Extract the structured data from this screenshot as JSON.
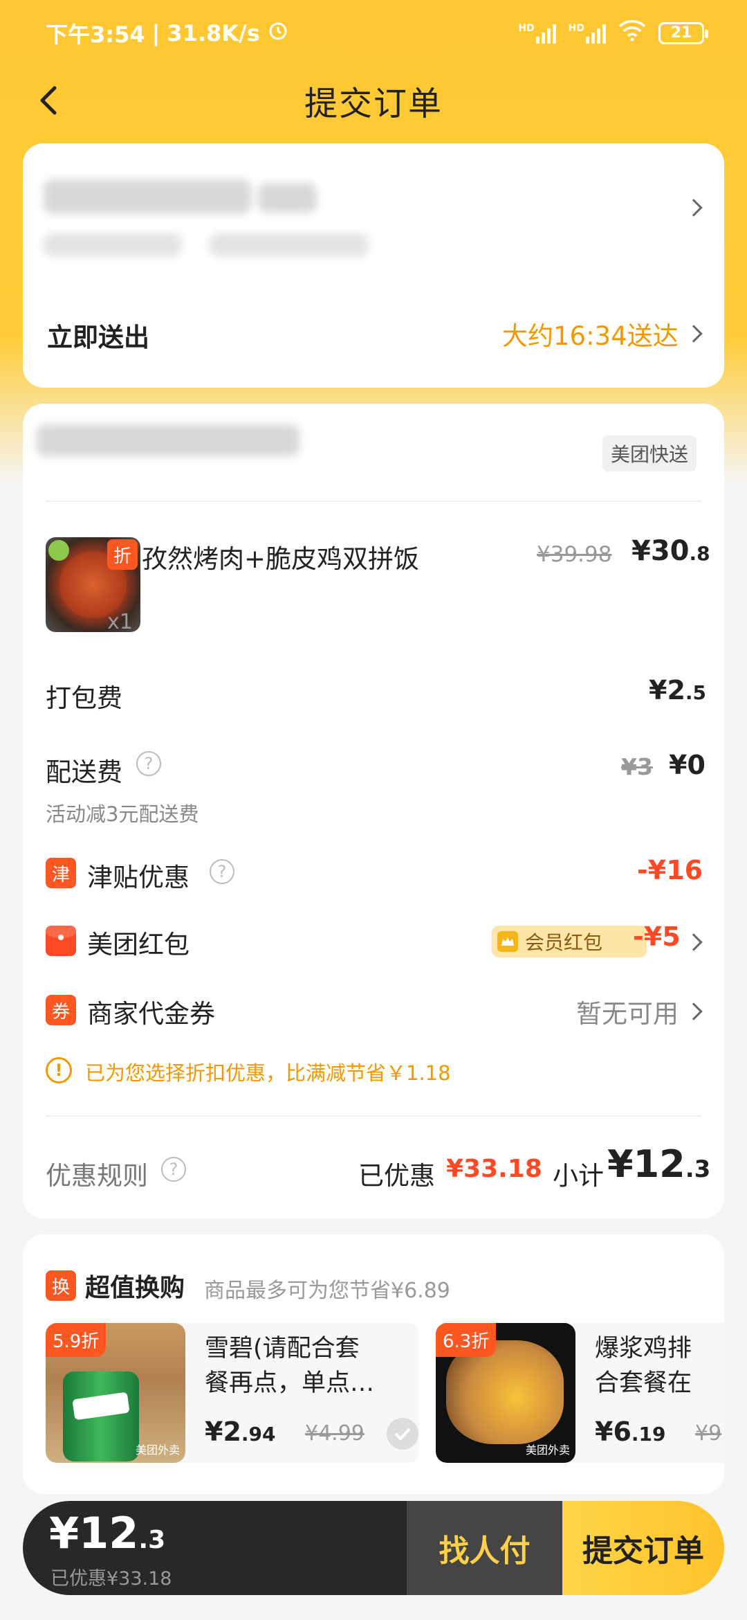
{
  "status_bar": {
    "time": "下午3:54",
    "speed": "31.8K/s",
    "hd1": "HD",
    "hd2": "HD",
    "battery": "21"
  },
  "nav": {
    "title": "提交订单"
  },
  "address": {
    "delivery_label": "立即送出",
    "eta": "大约16:34送达"
  },
  "order": {
    "delivery_badge": "美团快送",
    "item": {
      "tag": "折",
      "name": "孜然烤肉+脆皮鸡双拼饭",
      "original_price": "¥39.98",
      "price_main": "¥30",
      "price_dec": ".8",
      "qty": "x1"
    },
    "packing": {
      "label": "打包费",
      "main": "¥2",
      "dec": ".5"
    },
    "delivery_fee": {
      "label": "配送费",
      "help": "?",
      "original": "¥3",
      "value": "¥0",
      "note": "活动减3元配送费"
    },
    "subsidy": {
      "tag": "津",
      "label": "津贴优惠",
      "help": "?",
      "value": "-¥16"
    },
    "redpacket": {
      "label": "美团红包",
      "member_badge": "会员红包",
      "value": "-¥5"
    },
    "voucher": {
      "tag": "券",
      "label": "商家代金券",
      "value": "暂无可用"
    },
    "notice": "已为您选择折扣优惠，比满减节省￥1.18",
    "rules_label": "优惠规则",
    "rules_help": "?",
    "saved_label": "已优惠",
    "saved_value": "¥33.18",
    "subtotal_label": "小计",
    "subtotal_main": "¥12",
    "subtotal_dec": ".3"
  },
  "swap": {
    "tag": "换",
    "title": "超值换购",
    "subtitle": "商品最多可为您节省¥6.89",
    "items": [
      {
        "discount": "5.9折",
        "name_line1": "雪碧(请配合套",
        "name_line2": "餐再点，单点…",
        "price_main": "¥2",
        "price_dec": ".94",
        "original": "¥4.99",
        "watermark": "美团外卖"
      },
      {
        "discount": "6.3折",
        "name_line1": "爆浆鸡排",
        "name_line2": "合套餐在",
        "price_main": "¥6",
        "price_dec": ".19",
        "original": "¥9",
        "watermark": "美团外卖"
      }
    ]
  },
  "bottom": {
    "total_main": "¥12",
    "total_dec": ".3",
    "saved": "已优惠¥33.18",
    "find_pay": "找人付",
    "submit": "提交订单"
  },
  "colors": {
    "brand_yellow": "#ffc832",
    "accent_orange": "#f39800",
    "discount_red": "#ff4a26"
  }
}
